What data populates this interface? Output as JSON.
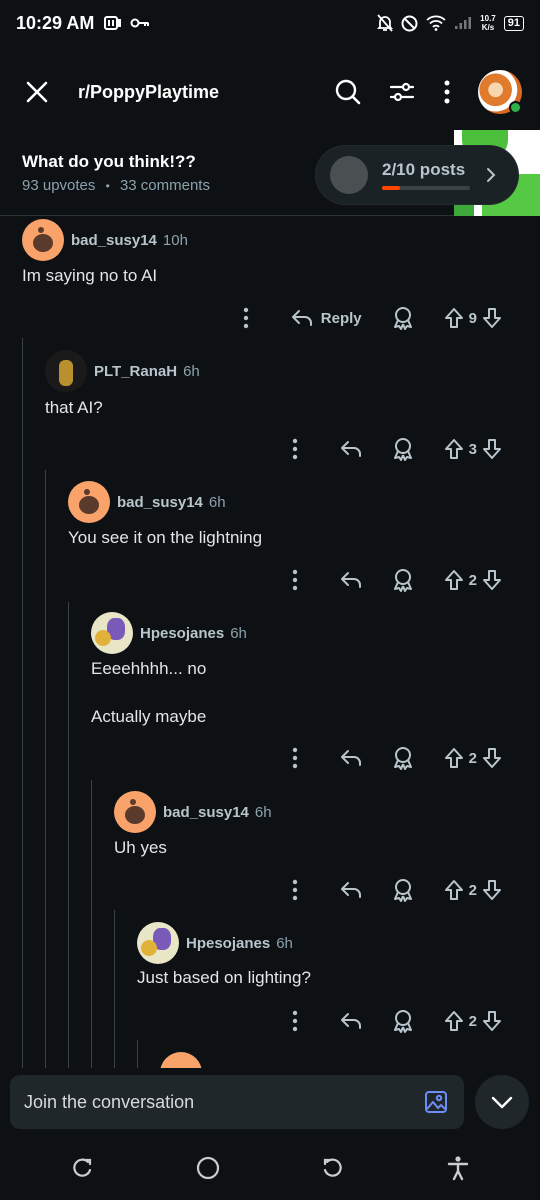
{
  "status_bar": {
    "time": "10:29 AM",
    "net_speed_value": "10.7",
    "net_speed_unit": "K/s",
    "battery": "91"
  },
  "header": {
    "subreddit": "r/PoppyPlaytime"
  },
  "post": {
    "title": "What do you think!??",
    "upvotes": "93 upvotes",
    "separator": "•",
    "comments": "33 comments"
  },
  "posts_navigator": {
    "label": "2/10 posts",
    "progress": 0.2
  },
  "comments": [
    {
      "author": "bad_susy14",
      "age": "10h",
      "body": "Im saying no to AI",
      "votes": "9",
      "reply_label": "Reply"
    },
    {
      "author": "PLT_RanaH",
      "age": "6h",
      "body": "that AI?",
      "votes": "3"
    },
    {
      "author": "bad_susy14",
      "age": "6h",
      "body": "You see it on the lightning",
      "votes": "2"
    },
    {
      "author": "Hpesojanes",
      "age": "6h",
      "body_line1": "Eeeehhhh... no",
      "body_line2": "Actually maybe",
      "votes": "2"
    },
    {
      "author": "bad_susy14",
      "age": "6h",
      "body": "Uh yes",
      "votes": "2"
    },
    {
      "author": "Hpesojanes",
      "age": "6h",
      "body": "Just based on lighting?",
      "votes": "2"
    }
  ],
  "composer": {
    "placeholder": "Join the conversation"
  },
  "colors": {
    "background": "#0e1113",
    "accent": "#ff4500",
    "online": "#2bb34a",
    "text_muted": "#8ba2ad"
  }
}
